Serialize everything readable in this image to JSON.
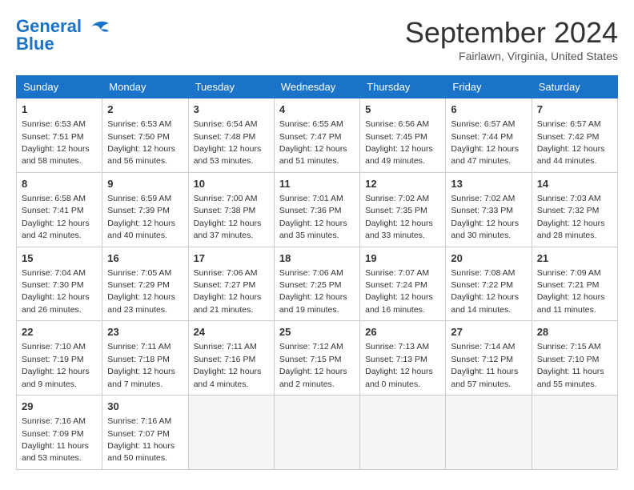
{
  "logo": {
    "line1": "General",
    "line2": "Blue"
  },
  "title": "September 2024",
  "subtitle": "Fairlawn, Virginia, United States",
  "weekdays": [
    "Sunday",
    "Monday",
    "Tuesday",
    "Wednesday",
    "Thursday",
    "Friday",
    "Saturday"
  ],
  "weeks": [
    [
      {
        "day": 1,
        "sunrise": "6:53 AM",
        "sunset": "7:51 PM",
        "daylight": "12 hours and 58 minutes."
      },
      {
        "day": 2,
        "sunrise": "6:53 AM",
        "sunset": "7:50 PM",
        "daylight": "12 hours and 56 minutes."
      },
      {
        "day": 3,
        "sunrise": "6:54 AM",
        "sunset": "7:48 PM",
        "daylight": "12 hours and 53 minutes."
      },
      {
        "day": 4,
        "sunrise": "6:55 AM",
        "sunset": "7:47 PM",
        "daylight": "12 hours and 51 minutes."
      },
      {
        "day": 5,
        "sunrise": "6:56 AM",
        "sunset": "7:45 PM",
        "daylight": "12 hours and 49 minutes."
      },
      {
        "day": 6,
        "sunrise": "6:57 AM",
        "sunset": "7:44 PM",
        "daylight": "12 hours and 47 minutes."
      },
      {
        "day": 7,
        "sunrise": "6:57 AM",
        "sunset": "7:42 PM",
        "daylight": "12 hours and 44 minutes."
      }
    ],
    [
      {
        "day": 8,
        "sunrise": "6:58 AM",
        "sunset": "7:41 PM",
        "daylight": "12 hours and 42 minutes."
      },
      {
        "day": 9,
        "sunrise": "6:59 AM",
        "sunset": "7:39 PM",
        "daylight": "12 hours and 40 minutes."
      },
      {
        "day": 10,
        "sunrise": "7:00 AM",
        "sunset": "7:38 PM",
        "daylight": "12 hours and 37 minutes."
      },
      {
        "day": 11,
        "sunrise": "7:01 AM",
        "sunset": "7:36 PM",
        "daylight": "12 hours and 35 minutes."
      },
      {
        "day": 12,
        "sunrise": "7:02 AM",
        "sunset": "7:35 PM",
        "daylight": "12 hours and 33 minutes."
      },
      {
        "day": 13,
        "sunrise": "7:02 AM",
        "sunset": "7:33 PM",
        "daylight": "12 hours and 30 minutes."
      },
      {
        "day": 14,
        "sunrise": "7:03 AM",
        "sunset": "7:32 PM",
        "daylight": "12 hours and 28 minutes."
      }
    ],
    [
      {
        "day": 15,
        "sunrise": "7:04 AM",
        "sunset": "7:30 PM",
        "daylight": "12 hours and 26 minutes."
      },
      {
        "day": 16,
        "sunrise": "7:05 AM",
        "sunset": "7:29 PM",
        "daylight": "12 hours and 23 minutes."
      },
      {
        "day": 17,
        "sunrise": "7:06 AM",
        "sunset": "7:27 PM",
        "daylight": "12 hours and 21 minutes."
      },
      {
        "day": 18,
        "sunrise": "7:06 AM",
        "sunset": "7:25 PM",
        "daylight": "12 hours and 19 minutes."
      },
      {
        "day": 19,
        "sunrise": "7:07 AM",
        "sunset": "7:24 PM",
        "daylight": "12 hours and 16 minutes."
      },
      {
        "day": 20,
        "sunrise": "7:08 AM",
        "sunset": "7:22 PM",
        "daylight": "12 hours and 14 minutes."
      },
      {
        "day": 21,
        "sunrise": "7:09 AM",
        "sunset": "7:21 PM",
        "daylight": "12 hours and 11 minutes."
      }
    ],
    [
      {
        "day": 22,
        "sunrise": "7:10 AM",
        "sunset": "7:19 PM",
        "daylight": "12 hours and 9 minutes."
      },
      {
        "day": 23,
        "sunrise": "7:11 AM",
        "sunset": "7:18 PM",
        "daylight": "12 hours and 7 minutes."
      },
      {
        "day": 24,
        "sunrise": "7:11 AM",
        "sunset": "7:16 PM",
        "daylight": "12 hours and 4 minutes."
      },
      {
        "day": 25,
        "sunrise": "7:12 AM",
        "sunset": "7:15 PM",
        "daylight": "12 hours and 2 minutes."
      },
      {
        "day": 26,
        "sunrise": "7:13 AM",
        "sunset": "7:13 PM",
        "daylight": "12 hours and 0 minutes."
      },
      {
        "day": 27,
        "sunrise": "7:14 AM",
        "sunset": "7:12 PM",
        "daylight": "11 hours and 57 minutes."
      },
      {
        "day": 28,
        "sunrise": "7:15 AM",
        "sunset": "7:10 PM",
        "daylight": "11 hours and 55 minutes."
      }
    ],
    [
      {
        "day": 29,
        "sunrise": "7:16 AM",
        "sunset": "7:09 PM",
        "daylight": "11 hours and 53 minutes."
      },
      {
        "day": 30,
        "sunrise": "7:16 AM",
        "sunset": "7:07 PM",
        "daylight": "11 hours and 50 minutes."
      },
      null,
      null,
      null,
      null,
      null
    ]
  ]
}
